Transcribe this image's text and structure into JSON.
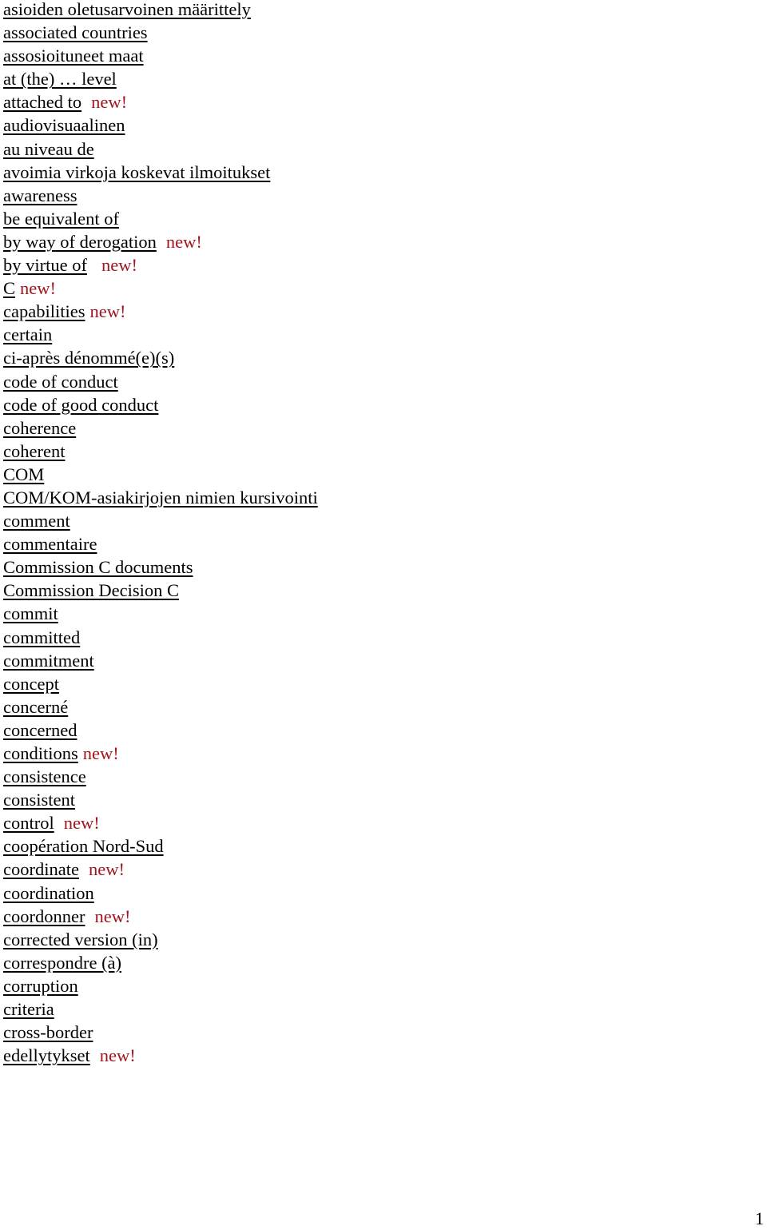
{
  "accent_colors": {
    "new_badge": "#a0141e",
    "link_text": "#000000"
  },
  "new_label": "new!",
  "terms": [
    {
      "label": "asioiden oletusarvoinen määrittely",
      "is_new": false
    },
    {
      "label": "associated countries",
      "is_new": false
    },
    {
      "label": "assosioituneet maat",
      "is_new": false
    },
    {
      "label": "at (the) … level",
      "is_new": false
    },
    {
      "label": "attached to",
      "is_new": true
    },
    {
      "label": "audiovisuaalinen",
      "is_new": false
    },
    {
      "label": "au niveau de",
      "is_new": false
    },
    {
      "label": "avoimia virkoja koskevat ilmoitukset",
      "is_new": false
    },
    {
      "label": "awareness",
      "is_new": false
    },
    {
      "label": "be equivalent of",
      "is_new": false
    },
    {
      "label": "by way of derogation",
      "is_new": true
    },
    {
      "label": "by virtue of",
      "is_new": true
    },
    {
      "label": "C",
      "is_new": true
    },
    {
      "label": "capabilities",
      "is_new": true
    },
    {
      "label": "certain",
      "is_new": false
    },
    {
      "label": "ci-après dénommé(e)(s)",
      "is_new": false
    },
    {
      "label": "code of conduct",
      "is_new": false
    },
    {
      "label": "code of good conduct",
      "is_new": false
    },
    {
      "label": "coherence",
      "is_new": false
    },
    {
      "label": "coherent",
      "is_new": false
    },
    {
      "label": "COM",
      "is_new": false
    },
    {
      "label": "COM/KOM-asiakirjojen nimien kursivointi",
      "is_new": false
    },
    {
      "label": "comment",
      "is_new": false
    },
    {
      "label": "commentaire",
      "is_new": false
    },
    {
      "label": "Commission C documents",
      "is_new": false
    },
    {
      "label": "Commission Decision C",
      "is_new": false
    },
    {
      "label": "commit",
      "is_new": false
    },
    {
      "label": "committed",
      "is_new": false
    },
    {
      "label": "commitment",
      "is_new": false
    },
    {
      "label": "concept",
      "is_new": false
    },
    {
      "label": "concerné",
      "is_new": false
    },
    {
      "label": "concerned",
      "is_new": false
    },
    {
      "label": "conditions",
      "is_new": true
    },
    {
      "label": "consistence",
      "is_new": false
    },
    {
      "label": "consistent",
      "is_new": false
    },
    {
      "label": "control",
      "is_new": true
    },
    {
      "label": "coopération Nord-Sud",
      "is_new": false
    },
    {
      "label": "coordinate",
      "is_new": true
    },
    {
      "label": "coordination",
      "is_new": false
    },
    {
      "label": "coordonner",
      "is_new": true
    },
    {
      "label": "corrected version (in)",
      "is_new": false
    },
    {
      "label": "correspondre (à)",
      "is_new": false
    },
    {
      "label": "corruption",
      "is_new": false
    },
    {
      "label": "criteria",
      "is_new": false
    },
    {
      "label": "cross-border",
      "is_new": false
    },
    {
      "label": "edellytykset",
      "is_new": true
    }
  ],
  "page_number": "1"
}
